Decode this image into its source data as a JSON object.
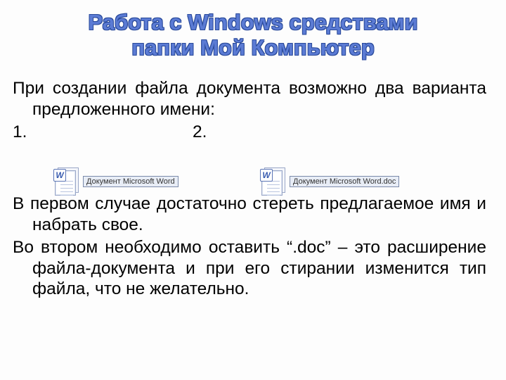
{
  "title": {
    "line1": "Работа с Windows средствами",
    "line2": "папки Мой Компьютер"
  },
  "intro": "При создании файла документа возможно два варианта предложенного имени:",
  "variants": {
    "num1": "1.",
    "num2": "2.",
    "file1_label": "Документ Microsoft Word",
    "file2_label": "Документ Microsoft Word.doc",
    "word_badge": "W"
  },
  "para1": "В первом случае достаточно стереть предлагаемое имя и набрать свое.",
  "para2": "Во втором необходимо оставить “.doc” – это расширение файла-документа и при его стирании изменится тип файла, что не желательно."
}
